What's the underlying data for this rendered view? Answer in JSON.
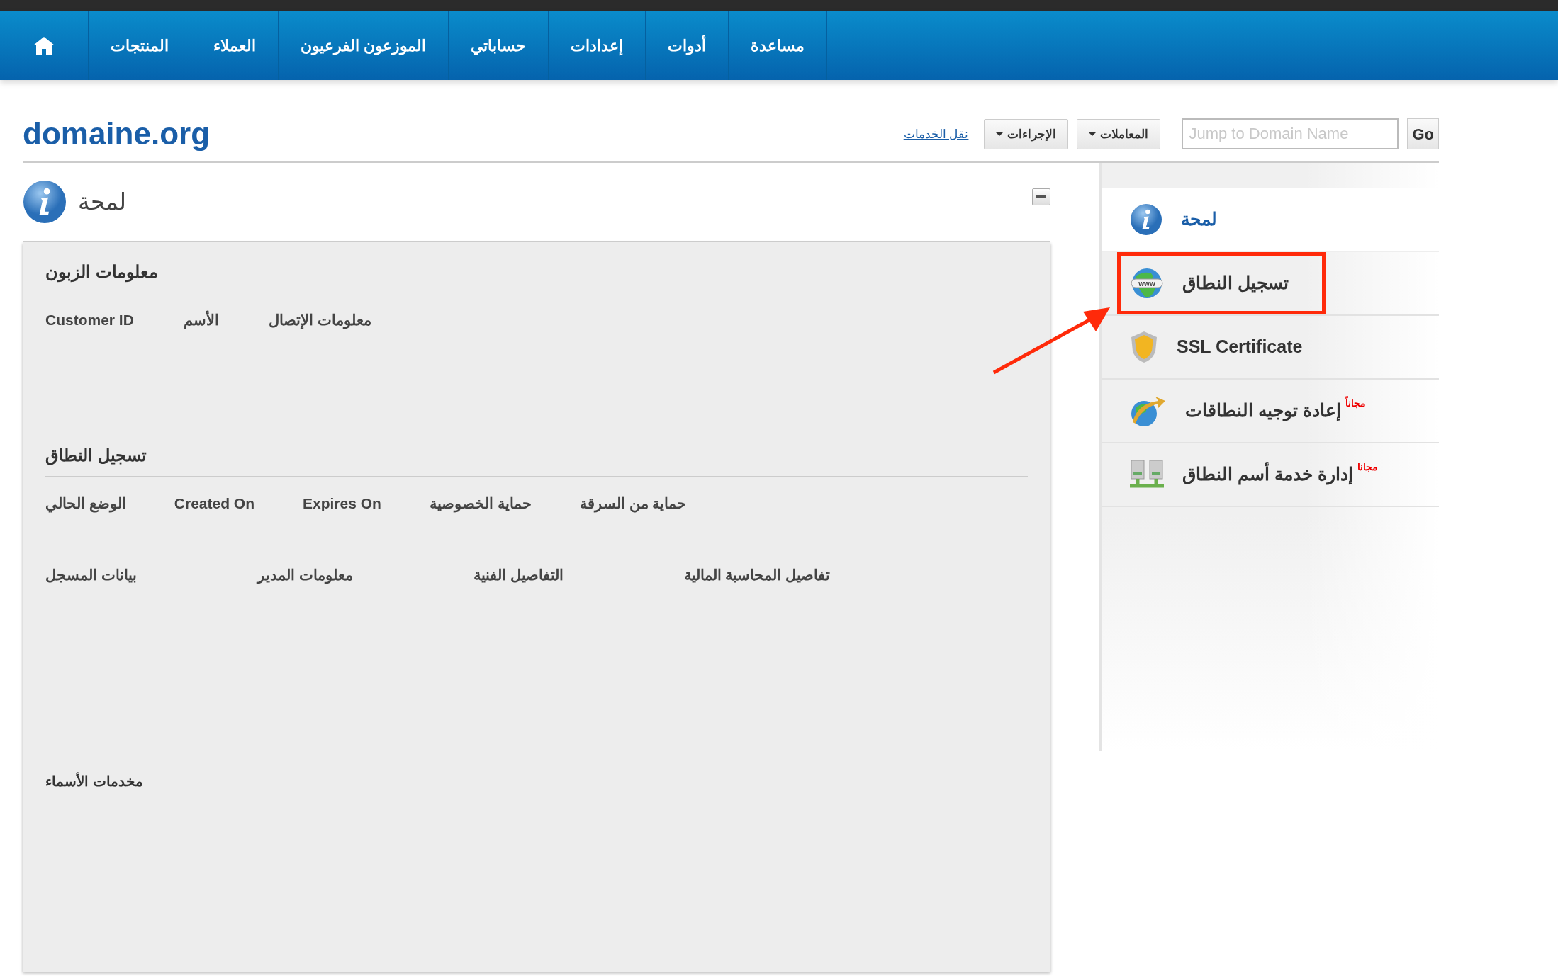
{
  "nav": {
    "items": [
      {
        "label": "مساعدة"
      },
      {
        "label": "أدوات"
      },
      {
        "label": "إعدادات"
      },
      {
        "label": "حساباتي"
      },
      {
        "label": "الموزعون الفرعيون"
      },
      {
        "label": "العملاء"
      },
      {
        "label": "المنتجات"
      }
    ]
  },
  "header": {
    "title": "domaine.org",
    "link": "نقل الخدمات",
    "dropdowns": [
      "المعاملات",
      "الإجراءات"
    ],
    "search": {
      "placeholder": "Jump to Domain Name"
    },
    "go": "Go"
  },
  "panel": {
    "title": "لمحة",
    "blocks": [
      {
        "kind": "section",
        "title": "معلومات الزبون",
        "rows": [
          [
            "معلومات الإتصال",
            "الأسم",
            "Customer ID"
          ]
        ]
      },
      {
        "kind": "section",
        "title": "تسجيل النطاق",
        "rows": [
          [
            "حماية من السرقة",
            "حماية الخصوصية",
            "Expires On",
            "Created On",
            "الوضع الحالي"
          ]
        ]
      },
      {
        "kind": "links",
        "labels": [
          "تفاصيل المحاسبة المالية",
          "التفاصيل الفنية",
          "معلومات المدير",
          "بيانات المسجل"
        ]
      },
      {
        "kind": "label",
        "title": "مخدمات الأسماء"
      }
    ]
  },
  "sidebar": {
    "items": [
      {
        "kind": "info",
        "label": "لمحة",
        "selected": true,
        "highlighted": false
      },
      {
        "kind": "www",
        "label": "تسجيل النطاق",
        "selected": false,
        "highlighted": true
      },
      {
        "kind": "shield",
        "label": "SSL Certificate",
        "selected": false,
        "highlighted": false
      },
      {
        "kind": "redirect",
        "label": "إعادة توجيه النطاقات",
        "badge": "مجاناً",
        "selected": false,
        "highlighted": false
      },
      {
        "kind": "servers",
        "label": "إدارة خدمة أسم النطاق",
        "badge": "مجانا",
        "selected": false,
        "highlighted": false
      }
    ]
  }
}
